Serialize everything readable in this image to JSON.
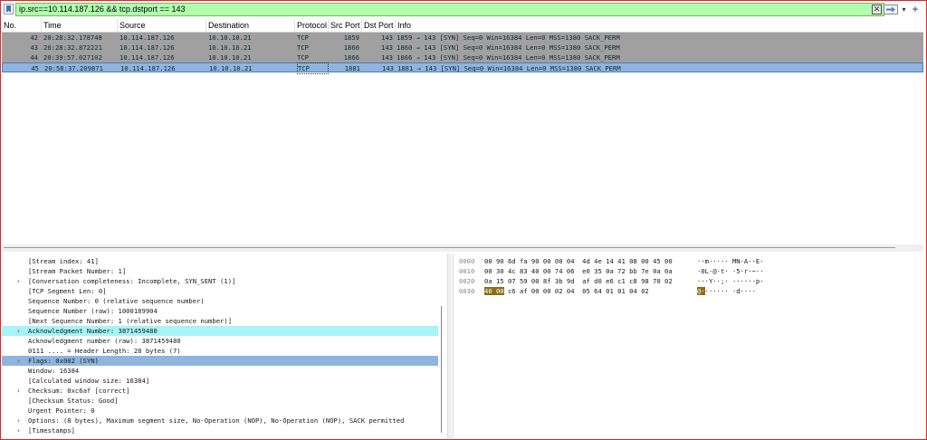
{
  "filter": {
    "value": "ip.src==10.114.187.126 &&  tcp.dstport == 143"
  },
  "columns": [
    "No.",
    "Time",
    "Source",
    "Destination",
    "Protocol",
    "Src Port",
    "Dst Port",
    "Info"
  ],
  "packets": [
    {
      "no": "42",
      "time": "20:28:32.178748",
      "src": "10.114.187.126",
      "dst": "10.10.10.21",
      "proto": "TCP",
      "sport": "1859",
      "dport": "143",
      "info": "1859 → 143 [SYN] Seq=0 Win=16384 Len=0 MSS=1380 SACK_PERM",
      "selected": false
    },
    {
      "no": "43",
      "time": "20:28:32.872221",
      "src": "10.114.187.126",
      "dst": "10.10.10.21",
      "proto": "TCP",
      "sport": "1860",
      "dport": "143",
      "info": "1860 → 143 [SYN] Seq=0 Win=16384 Len=0 MSS=1380 SACK_PERM",
      "selected": false
    },
    {
      "no": "44",
      "time": "20:39:57.027102",
      "src": "10.114.187.126",
      "dst": "10.10.10.21",
      "proto": "TCP",
      "sport": "1866",
      "dport": "143",
      "info": "1866 → 143 [SYN] Seq=0 Win=16384 Len=0 MSS=1380 SACK_PERM",
      "selected": false
    },
    {
      "no": "45",
      "time": "20:58:37.209871",
      "src": "10.114.187.126",
      "dst": "10.10.10.21",
      "proto": "TCP",
      "sport": "1881",
      "dport": "143",
      "info": "1881 → 143 [SYN] Seq=0 Win=16384 Len=0 MSS=1380 SACK_PERM",
      "selected": true
    }
  ],
  "details": [
    {
      "text": "[Stream index: 41]",
      "expandable": false,
      "highlight": ""
    },
    {
      "text": "[Stream Packet Number: 1]",
      "expandable": false,
      "highlight": ""
    },
    {
      "text": "[Conversation completeness: Incomplete, SYN_SENT (1)]",
      "expandable": true,
      "highlight": ""
    },
    {
      "text": "[TCP Segment Len: 0]",
      "expandable": false,
      "highlight": ""
    },
    {
      "text": "Sequence Number: 0    (relative sequence number)",
      "expandable": false,
      "highlight": ""
    },
    {
      "text": "Sequence Number (raw): 1000189904",
      "expandable": false,
      "highlight": ""
    },
    {
      "text": "[Next Sequence Number: 1    (relative sequence number)]",
      "expandable": false,
      "highlight": ""
    },
    {
      "text": "Acknowledgment Number: 3871459480",
      "expandable": true,
      "highlight": "cyan"
    },
    {
      "text": "Acknowledgment number (raw): 3871459480",
      "expandable": false,
      "highlight": ""
    },
    {
      "text": "0111 .... = Header Length: 28 bytes (7)",
      "expandable": false,
      "highlight": ""
    },
    {
      "text": "Flags: 0x002 (SYN)",
      "expandable": true,
      "highlight": "blue"
    },
    {
      "text": "Window: 16384",
      "expandable": false,
      "highlight": ""
    },
    {
      "text": "[Calculated window size: 16384]",
      "expandable": false,
      "highlight": ""
    },
    {
      "text": "Checksum: 0xc6af [correct]",
      "expandable": true,
      "highlight": ""
    },
    {
      "text": "[Checksum Status: Good]",
      "expandable": false,
      "highlight": ""
    },
    {
      "text": "Urgent Pointer: 0",
      "expandable": false,
      "highlight": ""
    },
    {
      "text": "Options: (8 bytes), Maximum segment size, No-Operation (NOP), No-Operation (NOP), SACK permitted",
      "expandable": true,
      "highlight": ""
    },
    {
      "text": "[Timestamps]",
      "expandable": true,
      "highlight": ""
    }
  ],
  "bytes": [
    {
      "offset": "0000",
      "hex_a": "00 90 6d fa 90 00 00 04  4d 4e 14 41 08 00 45 00",
      "hex_hl": "",
      "hex_b": "",
      "ascii_hl": "",
      "ascii": "··m····· MN·A··E·"
    },
    {
      "offset": "0010",
      "hex_a": "00 30 4c 83 40 00 74 06  e0 35 0a 72 bb 7e 0a 0a",
      "hex_hl": "",
      "hex_b": "",
      "ascii_hl": "",
      "ascii": "·0L·@·t· ·5·r·~··"
    },
    {
      "offset": "0020",
      "hex_a": "0a 15 07 59 00 8f 3b 9d  af d0 e6 c1 c8 98 70 02",
      "hex_hl": "",
      "hex_b": "",
      "ascii_hl": "",
      "ascii": "···Y··;· ······p·"
    },
    {
      "offset": "0030",
      "hex_a": "",
      "hex_hl": "40 00",
      "hex_b": " c6 af 00 00 02 04  05 64 01 01 04 02",
      "ascii_hl": "@·",
      "ascii": "······ ·d····"
    }
  ],
  "icons": {
    "bookmark": "bookmark-icon",
    "clear": "clear-filter-icon",
    "apply": "apply-filter-arrow-icon",
    "dropdown": "filter-history-dropdown-icon",
    "add": "add-filter-button-icon"
  },
  "colors": {
    "filter_valid_bg": "#afffaf",
    "row_bg": "#a0a0a0",
    "row_selected": "#8fb5df",
    "detail_cyan": "#a7f3f6",
    "byte_highlight": "#8a6d12",
    "frame_border": "#d8262d"
  }
}
